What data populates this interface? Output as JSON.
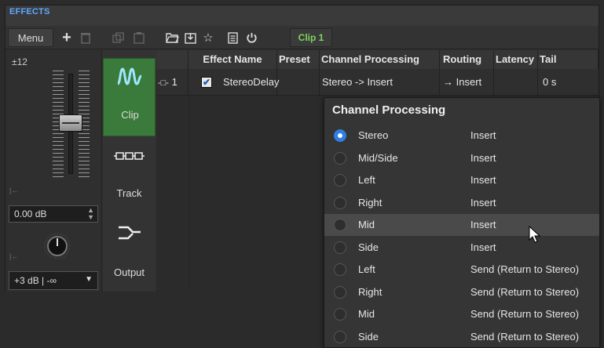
{
  "panel": {
    "title": "EFFECTS"
  },
  "toolbar": {
    "menu_label": "Menu",
    "add_icon": "plus-icon",
    "delete_icon": "trash-icon",
    "clip_label": "Clip 1"
  },
  "left": {
    "range_label": "±12",
    "gain_value": "0.00 dB",
    "limit_value": "+3 dB | -∞"
  },
  "routing": {
    "clip_label": "Clip",
    "track_label": "Track",
    "output_label": "Output"
  },
  "table": {
    "headers": [
      "Effect Name",
      "Preset",
      "Channel Processing",
      "Routing",
      "Latency",
      "Tail"
    ],
    "row": {
      "slot": "1",
      "effect_name": "StereoDelay",
      "preset": "",
      "channel_processing": "Stereo -> Insert",
      "routing": "Insert",
      "latency": "",
      "tail": "0 s"
    }
  },
  "dropdown": {
    "title": "Channel Processing",
    "items": [
      {
        "label": "Stereo",
        "route": "Insert",
        "selected": true
      },
      {
        "label": "Mid/Side",
        "route": "Insert",
        "selected": false
      },
      {
        "label": "Left",
        "route": "Insert",
        "selected": false
      },
      {
        "label": "Right",
        "route": "Insert",
        "selected": false
      },
      {
        "label": "Mid",
        "route": "Insert",
        "selected": false,
        "hovered": true
      },
      {
        "label": "Side",
        "route": "Insert",
        "selected": false
      },
      {
        "label": "Left",
        "route": "Send (Return to Stereo)",
        "selected": false
      },
      {
        "label": "Right",
        "route": "Send (Return to Stereo)",
        "selected": false
      },
      {
        "label": "Mid",
        "route": "Send (Return to Stereo)",
        "selected": false
      },
      {
        "label": "Side",
        "route": "Send (Return to Stereo)",
        "selected": false
      }
    ]
  },
  "colors": {
    "accent": "#5fa8ff",
    "clip_green": "#3a7a3a",
    "clip_text_green": "#7fd45d",
    "radio_selected": "#2f7fe0"
  }
}
